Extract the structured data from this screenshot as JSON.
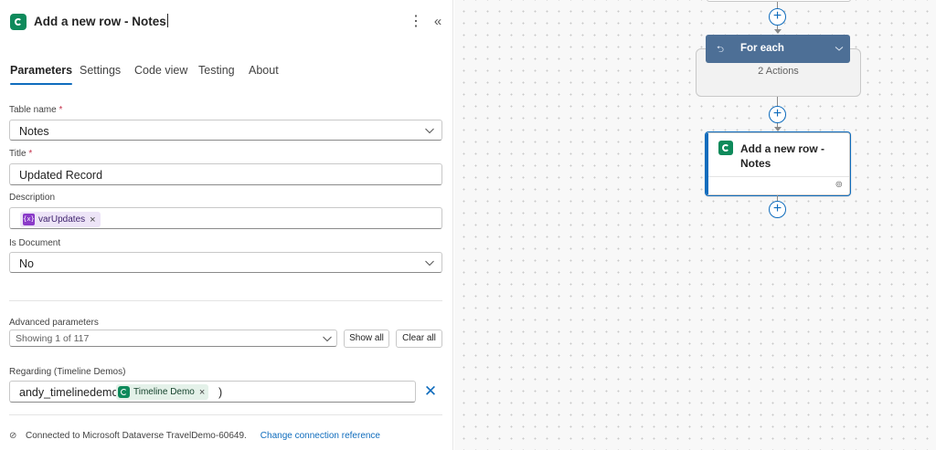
{
  "panel": {
    "title": "Add a new row - Notes",
    "more_icon": "⋮",
    "collapse_icon": "«",
    "tabs": [
      {
        "label": "Parameters",
        "active": true
      },
      {
        "label": "Settings",
        "active": false
      },
      {
        "label": "Code view",
        "active": false
      },
      {
        "label": "Testing",
        "active": false
      },
      {
        "label": "About",
        "active": false
      }
    ],
    "fields": {
      "table_name": {
        "label": "Table name",
        "required": "*",
        "value": "Notes"
      },
      "title": {
        "label": "Title",
        "required": "*",
        "value": "Updated Record"
      },
      "description": {
        "label": "Description",
        "token_icon": "{x}",
        "token": "varUpdates",
        "token_remove": "×"
      },
      "is_document": {
        "label": "Is Document",
        "value": "No"
      }
    },
    "advanced": {
      "label": "Advanced parameters",
      "value": "Showing 1 of 117",
      "show_all": "Show all",
      "clear_all": "Clear all"
    },
    "regarding": {
      "label": "Regarding (Timeline Demos)",
      "prefix": "andy_timelinedemos(",
      "token": "Timeline Demo",
      "token_remove": "×",
      "suffix": ")",
      "clear": "✕"
    },
    "connection": {
      "icon": "⊘",
      "text": "Connected to Microsoft Dataverse TravelDemo-60649.",
      "link": "Change connection reference"
    }
  },
  "canvas": {
    "plus": "+",
    "foreach": {
      "icon": "⮌",
      "title": "For each",
      "actions": "2 Actions"
    },
    "card": {
      "title": "Add a new row - Notes",
      "link_icon": "⊚"
    },
    "accent": "#0f6cbd",
    "dataverse_green": "#0e8a5b"
  }
}
